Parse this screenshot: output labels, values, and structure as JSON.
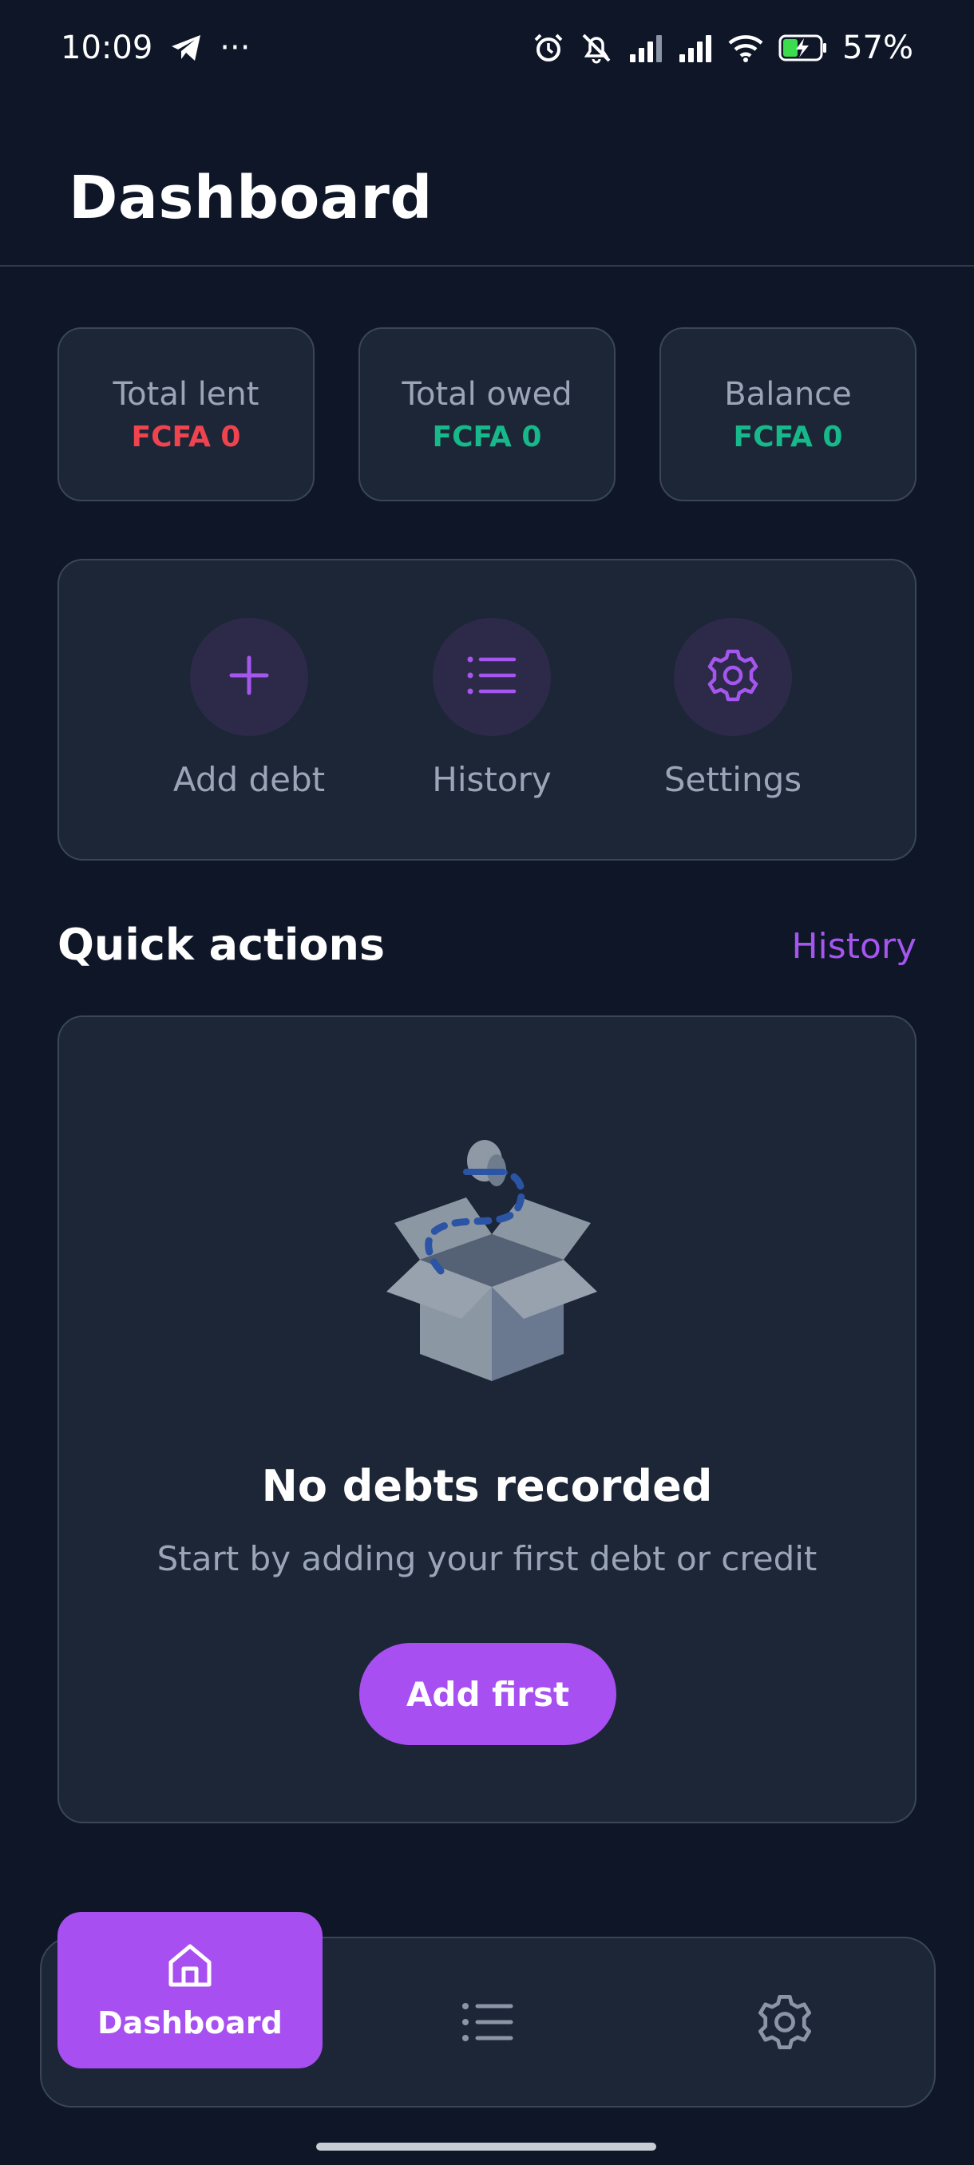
{
  "status_bar": {
    "time": "10:09",
    "overflow": "···",
    "battery": "57%",
    "icons": [
      "telegram-icon",
      "alarm-icon",
      "bell-muted-icon",
      "signal-icon",
      "signal-icon",
      "wifi-icon",
      "battery-charging-icon"
    ]
  },
  "header": {
    "title": "Dashboard"
  },
  "stats": [
    {
      "label": "Total lent",
      "value": "FCFA 0",
      "color": "#ef4450"
    },
    {
      "label": "Total owed",
      "value": "FCFA 0",
      "color": "#17b889"
    },
    {
      "label": "Balance",
      "value": "FCFA 0",
      "color": "#17b889"
    }
  ],
  "shortcuts": [
    {
      "label": "Add debt",
      "icon": "plus-icon"
    },
    {
      "label": "History",
      "icon": "list-icon"
    },
    {
      "label": "Settings",
      "icon": "gear-icon"
    }
  ],
  "quick_actions": {
    "title": "Quick actions",
    "link": "History"
  },
  "empty_state": {
    "title": "No debts recorded",
    "description": "Start by adding your first debt or credit",
    "button": "Add first",
    "icon": "empty-box-icon"
  },
  "bottom_nav": {
    "active_label": "Dashboard",
    "items": [
      {
        "icon": "home-icon"
      },
      {
        "icon": "list-icon"
      },
      {
        "icon": "gear-icon"
      }
    ]
  },
  "colors": {
    "background": "#0e1628",
    "card": "#1c2637",
    "accent": "#a74ff0",
    "negative": "#ef4450",
    "positive": "#17b889",
    "muted_text": "#9aa6b8"
  }
}
